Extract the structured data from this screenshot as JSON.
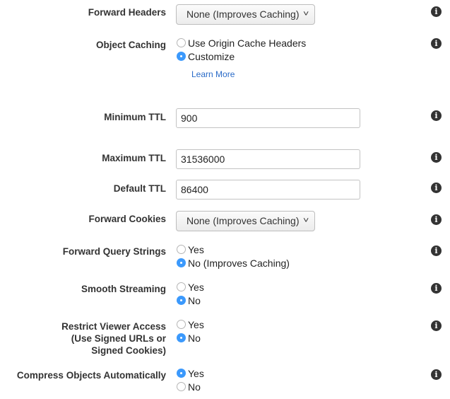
{
  "icons": {
    "info": "info-icon",
    "chevron": "chevron-down-icon"
  },
  "colors": {
    "radio_checked": "#3b99fc",
    "link": "#2a6bc8",
    "label": "#333333"
  },
  "fields": {
    "forward_headers": {
      "label": "Forward Headers",
      "value": "None (Improves Caching)",
      "chevron": "⌄"
    },
    "object_caching": {
      "label": "Object Caching",
      "options": [
        {
          "label": "Use Origin Cache Headers",
          "checked": false
        },
        {
          "label": "Customize",
          "checked": true
        }
      ],
      "learn_more": "Learn More"
    },
    "minimum_ttl": {
      "label": "Minimum TTL",
      "value": "900"
    },
    "maximum_ttl": {
      "label": "Maximum TTL",
      "value": "31536000"
    },
    "default_ttl": {
      "label": "Default TTL",
      "value": "86400"
    },
    "forward_cookies": {
      "label": "Forward Cookies",
      "value": "None (Improves Caching)",
      "chevron": "⌄"
    },
    "forward_query_strings": {
      "label": "Forward Query Strings",
      "options": [
        {
          "label": "Yes",
          "checked": false
        },
        {
          "label": "No (Improves Caching)",
          "checked": true
        }
      ]
    },
    "smooth_streaming": {
      "label": "Smooth Streaming",
      "options": [
        {
          "label": "Yes",
          "checked": false
        },
        {
          "label": "No",
          "checked": true
        }
      ]
    },
    "restrict_viewer_access": {
      "label_lines": [
        "Restrict Viewer Access",
        "(Use Signed URLs or",
        "Signed Cookies)"
      ],
      "options": [
        {
          "label": "Yes",
          "checked": false
        },
        {
          "label": "No",
          "checked": true
        }
      ]
    },
    "compress_objects": {
      "label": "Compress Objects Automatically",
      "options": [
        {
          "label": "Yes",
          "checked": true
        },
        {
          "label": "No",
          "checked": false
        }
      ]
    }
  }
}
